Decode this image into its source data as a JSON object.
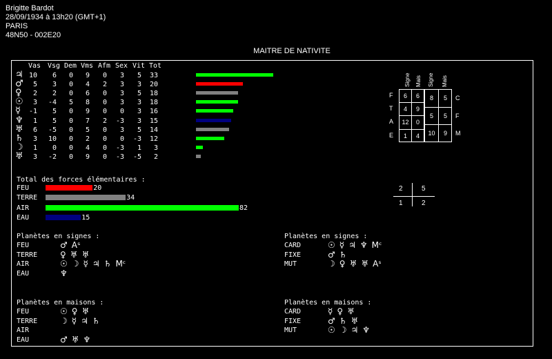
{
  "header": {
    "name": "Brigitte Bardot",
    "datetime": "28/09/1934 à 13h20 (GMT+1)",
    "city": "PARIS",
    "coords": "48N50 - 002E20"
  },
  "title": "MAITRE DE NATIVITE",
  "table": {
    "columns": [
      "Vas",
      "Vsg",
      "Dem",
      "Vms",
      "Afm",
      "Sex",
      "Vit",
      "Tot"
    ],
    "rows": [
      {
        "glyph": "♃",
        "values": [
          "10",
          "6",
          "0",
          "9",
          "0",
          "3",
          "5",
          "33"
        ],
        "bar": {
          "value": 33,
          "color": "#00ff00"
        }
      },
      {
        "glyph": "♂",
        "values": [
          "5",
          "3",
          "0",
          "4",
          "2",
          "3",
          "3",
          "20"
        ],
        "bar": {
          "value": 20,
          "color": "#ff0000"
        }
      },
      {
        "glyph": "♀",
        "values": [
          "2",
          "2",
          "0",
          "6",
          "0",
          "3",
          "5",
          "18"
        ],
        "bar": {
          "value": 18,
          "color": "#808080"
        }
      },
      {
        "glyph": "☉",
        "values": [
          "3",
          "-4",
          "5",
          "8",
          "0",
          "3",
          "3",
          "18"
        ],
        "bar": {
          "value": 18,
          "color": "#00ff00"
        }
      },
      {
        "glyph": "☿",
        "values": [
          "-1",
          "5",
          "0",
          "9",
          "0",
          "0",
          "3",
          "16"
        ],
        "bar": {
          "value": 16,
          "color": "#00ff00"
        }
      },
      {
        "glyph": "♆",
        "values": [
          "1",
          "5",
          "0",
          "7",
          "2",
          "-3",
          "3",
          "15"
        ],
        "bar": {
          "value": 15,
          "color": "#000080"
        }
      },
      {
        "glyph": "♅",
        "values": [
          "6",
          "-5",
          "0",
          "5",
          "0",
          "3",
          "5",
          "14"
        ],
        "bar": {
          "value": 14,
          "color": "#808080"
        }
      },
      {
        "glyph": "♄",
        "values": [
          "3",
          "10",
          "0",
          "2",
          "0",
          "0",
          "-3",
          "12"
        ],
        "bar": {
          "value": 12,
          "color": "#00ff00"
        }
      },
      {
        "glyph": "☽",
        "values": [
          "1",
          "0",
          "0",
          "4",
          "0",
          "-3",
          "1",
          "3"
        ],
        "bar": {
          "value": 3,
          "color": "#00ff00"
        }
      },
      {
        "glyph": "♅",
        "values": [
          "3",
          "-2",
          "0",
          "9",
          "0",
          "-3",
          "-5",
          "2"
        ],
        "bar": {
          "value": 2,
          "color": "#808080"
        }
      }
    ]
  },
  "elements": {
    "heading": "Total des forces élémentaires :",
    "items": [
      {
        "label": "FEU",
        "value": 20,
        "color": "#ff0000"
      },
      {
        "label": "TERRE",
        "value": 34,
        "color": "#808080"
      },
      {
        "label": "AIR",
        "value": 82,
        "color": "#00ff00"
      },
      {
        "label": "EAU",
        "value": 15,
        "color": "#000080"
      }
    ]
  },
  "grid": {
    "col_headers": [
      "Signe",
      "Mais",
      "Signe",
      "Mais"
    ],
    "left_labels": [
      "F",
      "T",
      "A",
      "E"
    ],
    "right_labels": [
      "C",
      "F",
      "M"
    ],
    "left_cells": [
      [
        "6",
        "6"
      ],
      [
        "4",
        "9"
      ],
      [
        "12",
        "0"
      ],
      [
        "1",
        "4"
      ]
    ],
    "right_cells": [
      [
        "8",
        "5"
      ],
      [
        "5",
        "5"
      ],
      [
        "10",
        "9"
      ]
    ]
  },
  "quadrant": {
    "tl": "2",
    "tr": "5",
    "bl": "1",
    "br": "2"
  },
  "signs_elements": {
    "heading": "Planètes en signes :",
    "rows": [
      {
        "label": "FEU",
        "glyphs": [
          "♂",
          "Aˢ"
        ]
      },
      {
        "label": "TERRE",
        "glyphs": [
          "♀",
          "♅",
          "♅"
        ]
      },
      {
        "label": "AIR",
        "glyphs": [
          "☉",
          "☽",
          "☿",
          "♃",
          "♄",
          "Mᶜ"
        ]
      },
      {
        "label": "EAU",
        "glyphs": [
          "♆"
        ]
      }
    ]
  },
  "signs_modes": {
    "heading": "Planètes en signes :",
    "rows": [
      {
        "label": "CARD",
        "glyphs": [
          "☉",
          "☿",
          "♃",
          "♆",
          "Mᶜ"
        ]
      },
      {
        "label": "FIXE",
        "glyphs": [
          "♂",
          "♄"
        ]
      },
      {
        "label": "MUT",
        "glyphs": [
          "☽",
          "♀",
          "♅",
          "♅",
          "Aˢ"
        ]
      }
    ]
  },
  "houses_elements": {
    "heading": "Planètes en maisons :",
    "rows": [
      {
        "label": "FEU",
        "glyphs": [
          "☉",
          "♀",
          "♅"
        ]
      },
      {
        "label": "TERRE",
        "glyphs": [
          "☽",
          "☿",
          "♃",
          "♄"
        ]
      },
      {
        "label": "AIR",
        "glyphs": []
      },
      {
        "label": "EAU",
        "glyphs": [
          "♂",
          "♅",
          "♆"
        ]
      }
    ]
  },
  "houses_modes": {
    "heading": "Planètes en maisons :",
    "rows": [
      {
        "label": "CARD",
        "glyphs": [
          "☿",
          "♀",
          "♅"
        ]
      },
      {
        "label": "FIXE",
        "glyphs": [
          "♂",
          "♄",
          "♅"
        ]
      },
      {
        "label": "MUT",
        "glyphs": [
          "☉",
          "☽",
          "♃",
          "♆"
        ]
      }
    ]
  }
}
